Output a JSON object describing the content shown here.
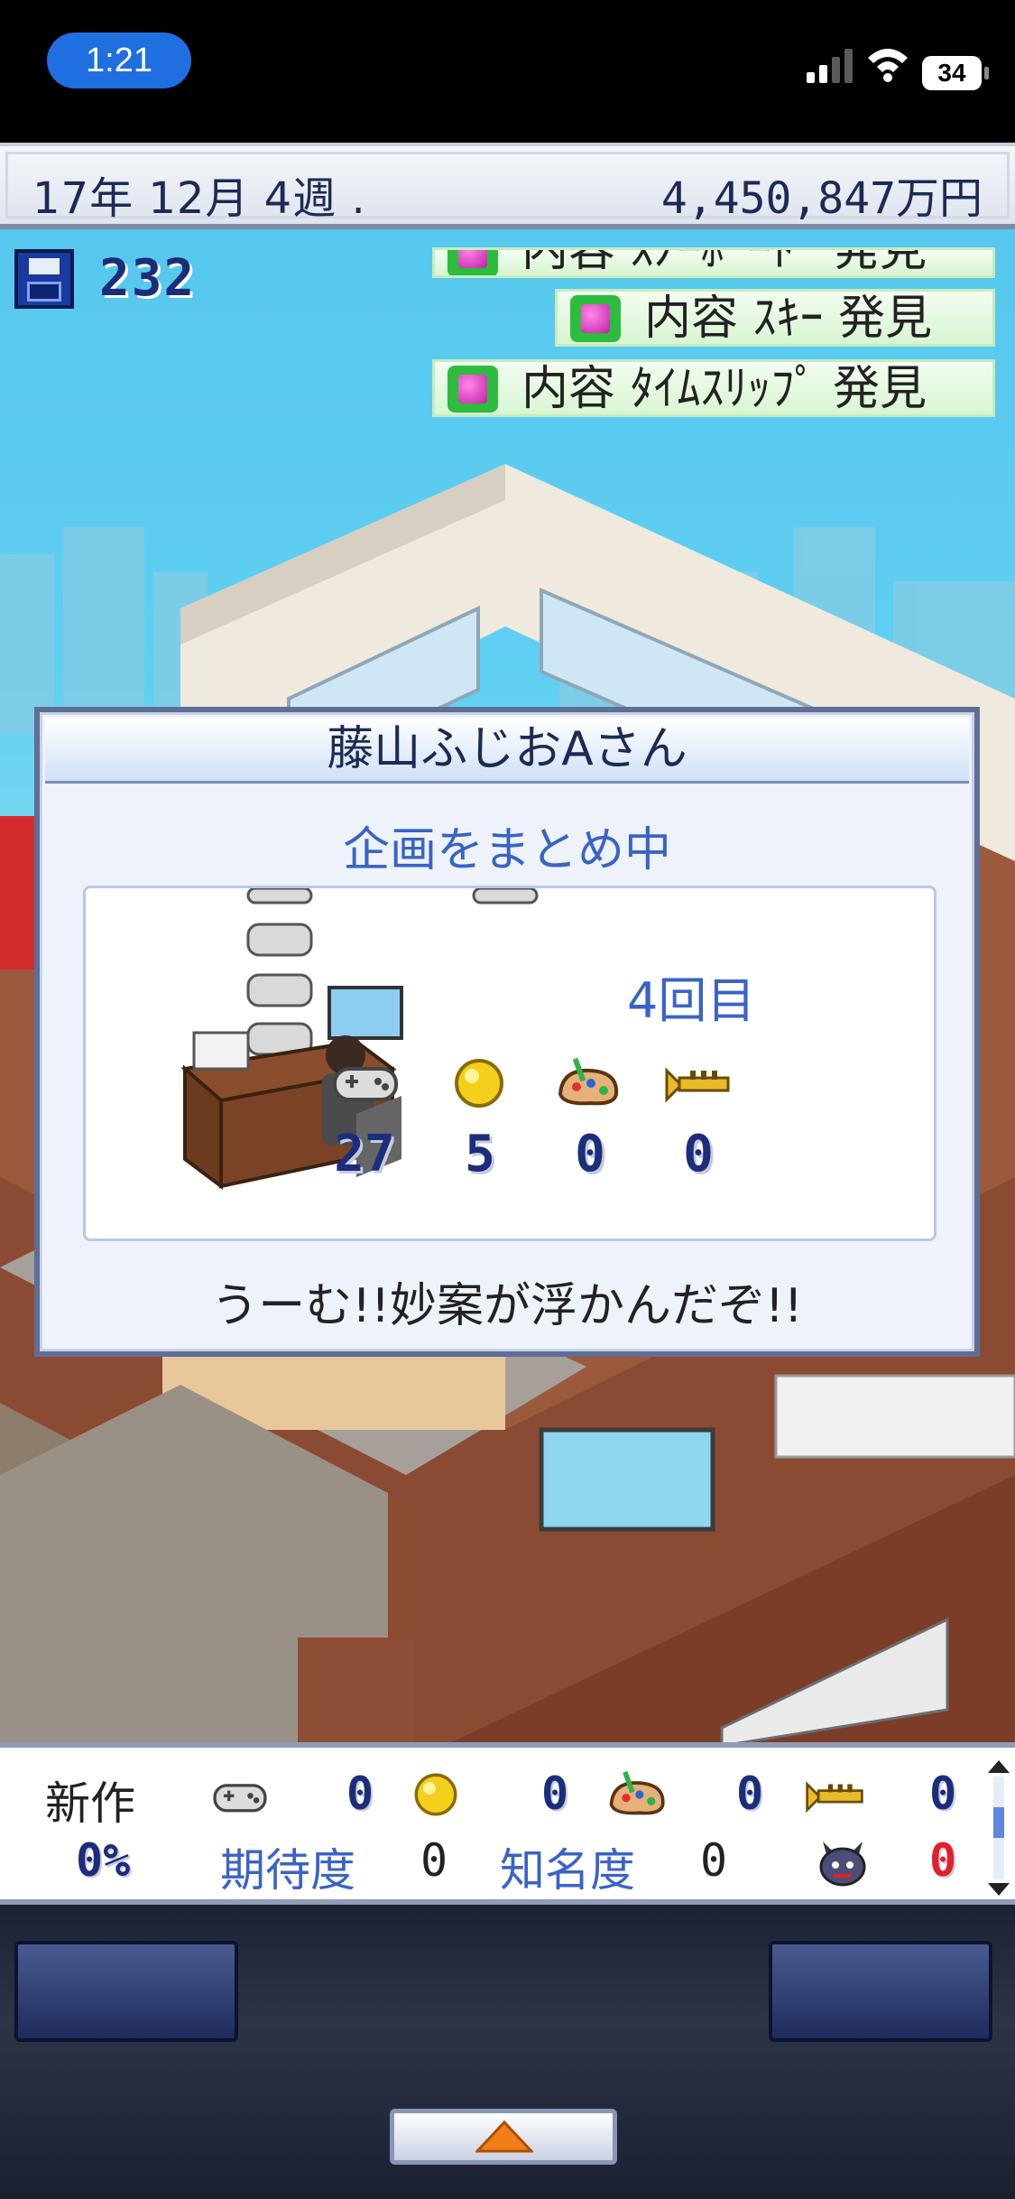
{
  "status_bar": {
    "time": "1:21",
    "battery": "34"
  },
  "top_bar": {
    "date": "17年 12月 4週 .",
    "money": "4,450,847万円"
  },
  "scene": {
    "save_count": "232",
    "notices": [
      "内容 ｽﾉｰﾎﾞｰﾄﾞ 発見",
      "内容 ｽｷｰ 発見",
      "内容 ﾀｲﾑｽﾘｯﾌﾟ 発見"
    ]
  },
  "modal": {
    "title": "藤山ふじおAさん",
    "subtitle": "企画をまとめ中",
    "round": "4回目",
    "stats": [
      {
        "icon": "controller-icon",
        "value": "27"
      },
      {
        "icon": "gold-orb-icon",
        "value": "5"
      },
      {
        "icon": "paint-palette-icon",
        "value": "0"
      },
      {
        "icon": "trumpet-icon",
        "value": "0"
      }
    ],
    "message": "うーむ!!妙案が浮かんだぞ!!"
  },
  "bottom_panel": {
    "new_work_label": "新作",
    "progress": "0%",
    "stats": [
      {
        "icon": "controller-icon",
        "value": "0"
      },
      {
        "icon": "gold-orb-icon",
        "value": "0"
      },
      {
        "icon": "paint-palette-icon",
        "value": "0"
      },
      {
        "icon": "trumpet-icon",
        "value": "0"
      }
    ],
    "expectation_label": "期待度",
    "expectation_value": "0",
    "fame_label": "知名度",
    "fame_value": "0",
    "bug_value": "0"
  },
  "colors": {
    "accent_blue": "#3a63c7",
    "number_navy": "#1c2d7c",
    "bug_red": "#e0202a"
  }
}
